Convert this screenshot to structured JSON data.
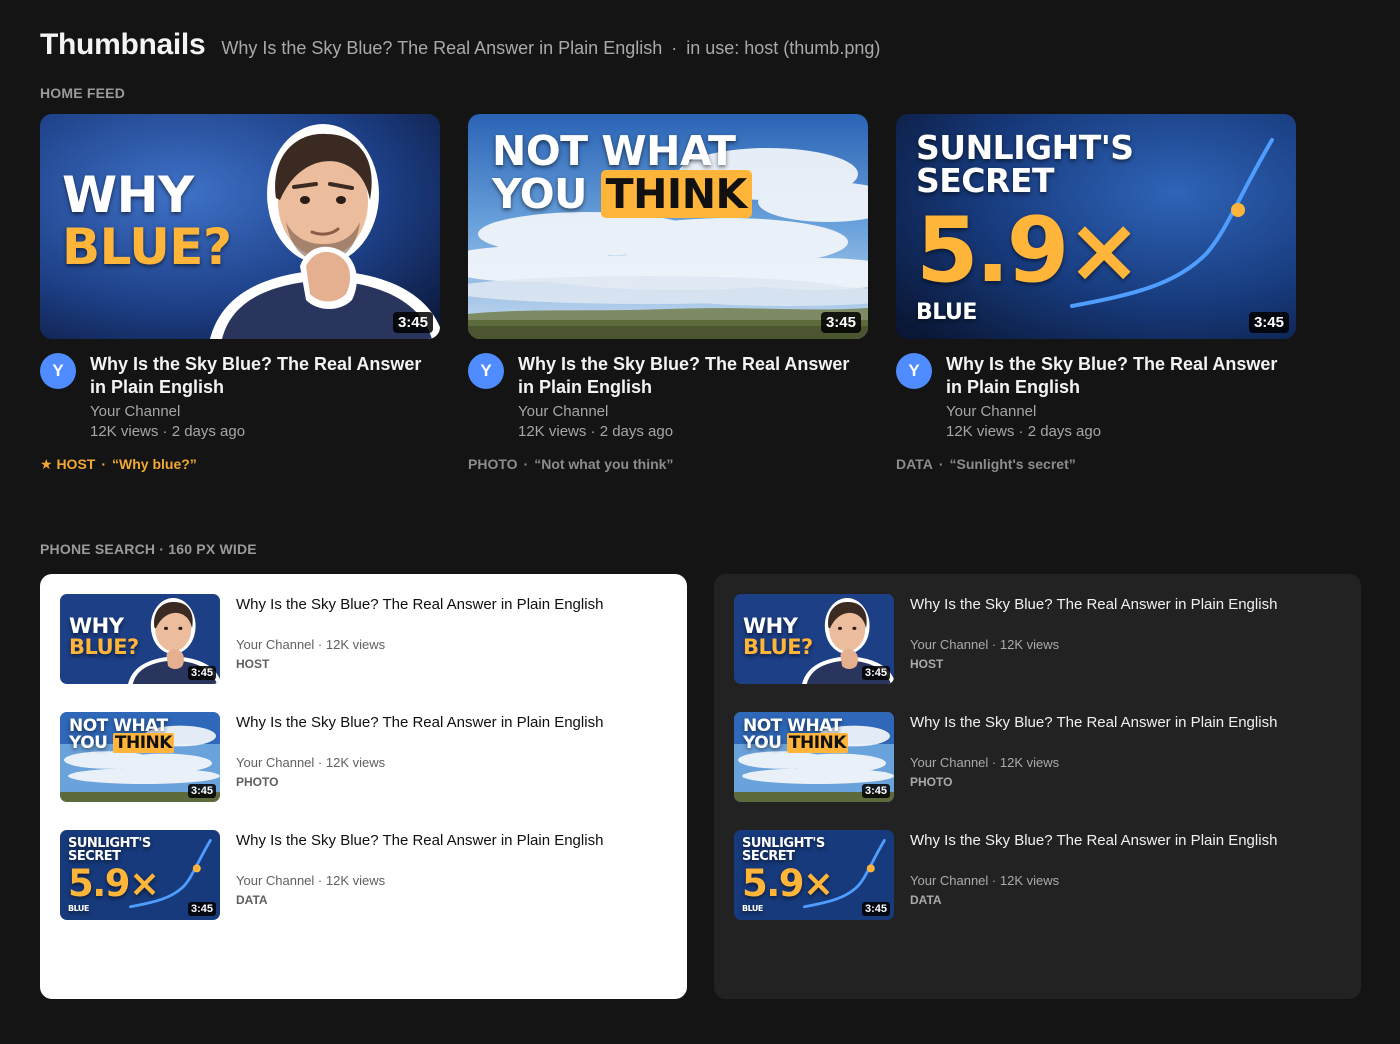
{
  "header": {
    "title": "Thumbnails",
    "video_title": "Why Is the Sky Blue? The Real Answer in Plain English",
    "dot": "·",
    "in_use": "in use: host (thumb.png)"
  },
  "sections": {
    "home_feed": "HOME FEED",
    "phone_search": "PHONE SEARCH · 160 PX WIDE"
  },
  "video": {
    "title": "Why Is the Sky Blue? The Real Answer in Plain English",
    "channel": "Your Channel",
    "views_age": "12K views · 2 days ago",
    "channel_views": "Your Channel · 12K views",
    "duration": "3:45",
    "avatar_letter": "Y"
  },
  "thumbnails": {
    "host": {
      "line1": "WHY",
      "line2": "BLUE?"
    },
    "photo": {
      "line1": "NOT WHAT",
      "line2a": "YOU",
      "line2b": "THINK"
    },
    "data": {
      "line1": "SUNLIGHT'S",
      "line2": "SECRET",
      "big": "5.9×",
      "small": "BLUE"
    }
  },
  "cards": [
    {
      "tag": "★ HOST",
      "sep": "·",
      "quote": "“Why blue?”",
      "variant": "host"
    },
    {
      "tag": "PHOTO",
      "sep": "·",
      "quote": "“Not what you think”",
      "variant": "photo"
    },
    {
      "tag": "DATA",
      "sep": "·",
      "quote": "“Sunlight's secret”",
      "variant": "data"
    }
  ],
  "phone_rows": [
    {
      "tag": "HOST"
    },
    {
      "tag": "PHOTO"
    },
    {
      "tag": "DATA"
    }
  ],
  "colors": {
    "background": "#141414",
    "accent_yellow": "#ffb43a",
    "avatar_blue": "#4f8cff",
    "chart_blue": "#4f9dff"
  },
  "icons": {
    "host": "person-portrait",
    "photo": "sky-clouds-photo",
    "data": "rising-curve-chart"
  }
}
